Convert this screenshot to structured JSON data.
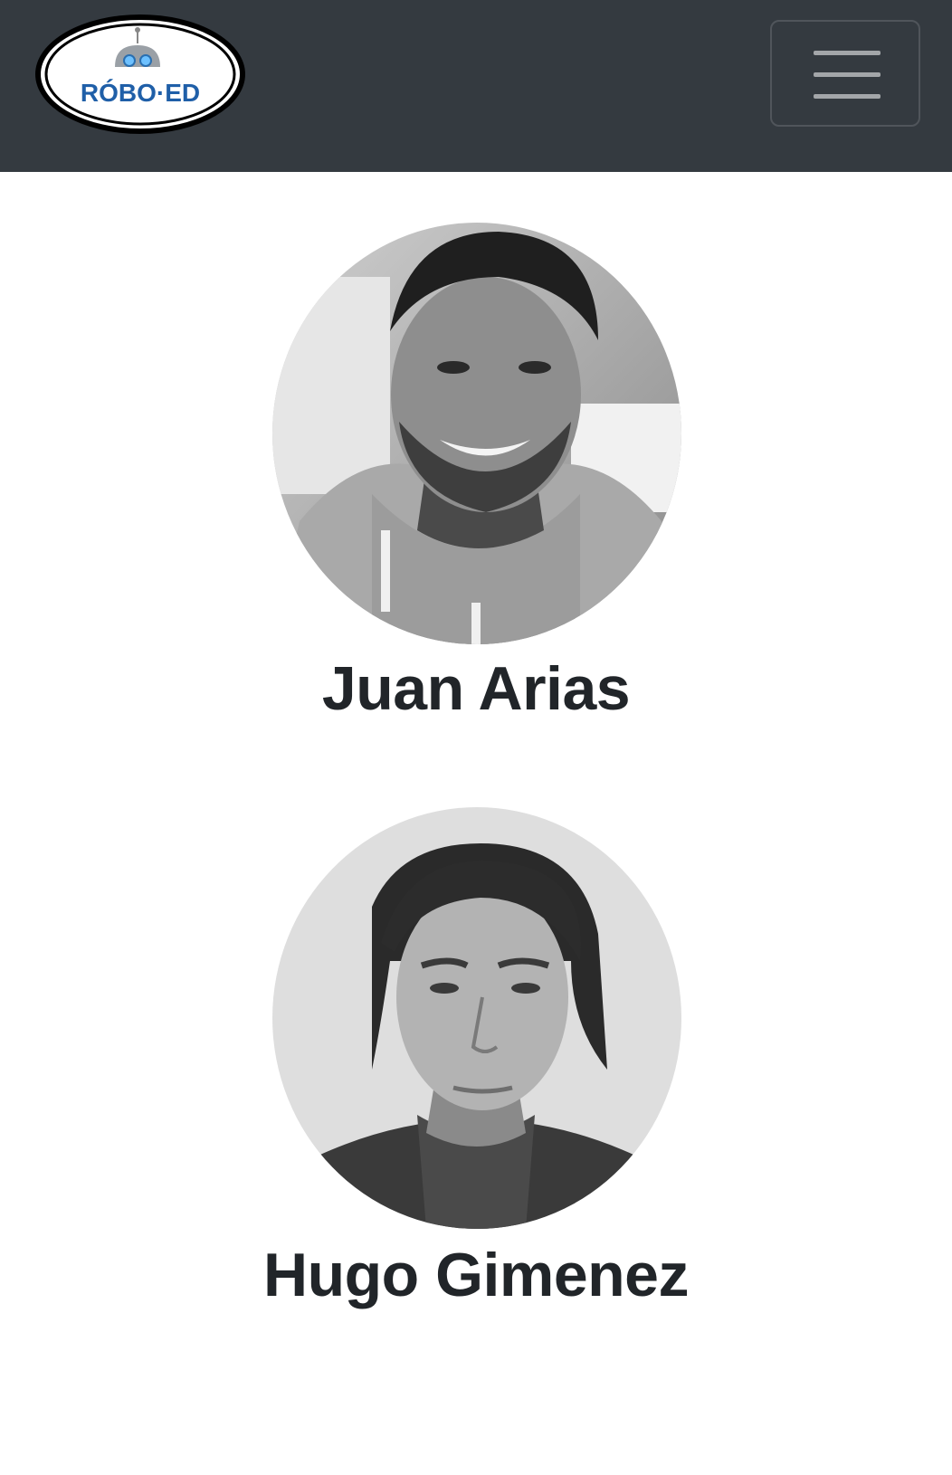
{
  "navbar": {
    "brand": {
      "logo_text": "RÓBO·ED",
      "logo_icon": "robot-head-icon"
    },
    "toggler": {
      "icon": "hamburger-menu-icon"
    },
    "colors": {
      "background": "#343a40",
      "logo_blue": "#1f5fa8"
    }
  },
  "team": {
    "members": [
      {
        "name": "Juan Arias",
        "photo_icon": "profile-photo"
      },
      {
        "name": "Hugo Gimenez",
        "photo_icon": "profile-photo"
      }
    ]
  }
}
